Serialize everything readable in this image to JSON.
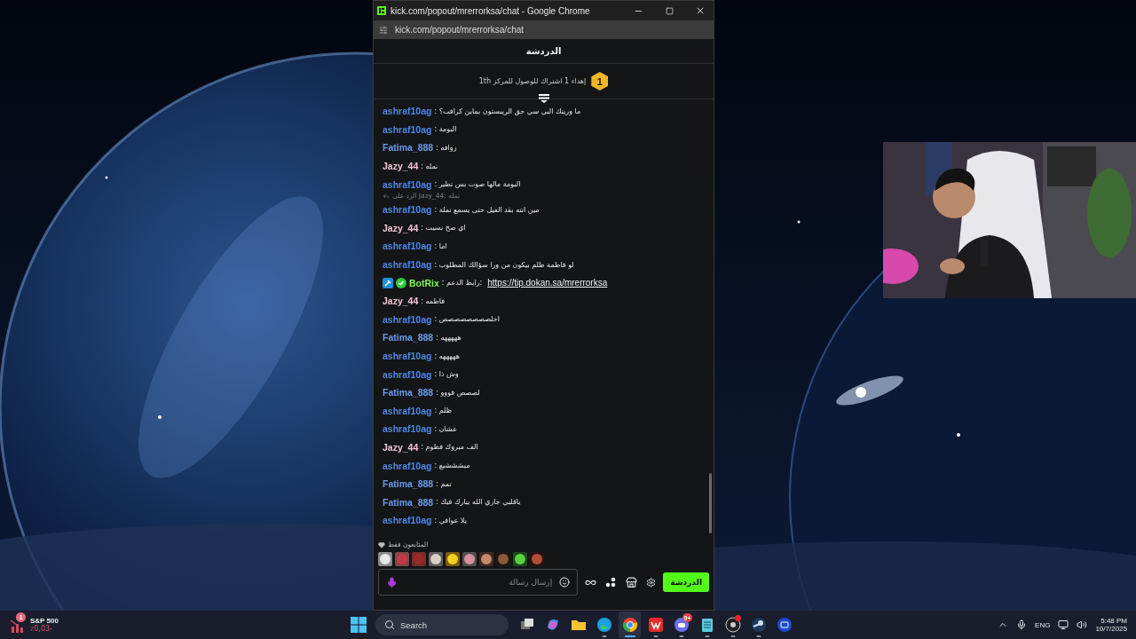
{
  "window": {
    "title": "kick.com/popout/mrerrorksa/chat - Google Chrome",
    "address": "kick.com/popout/mrerrorksa/chat"
  },
  "chat": {
    "title": "الدردشة",
    "pinned": {
      "badge": "1",
      "text": "إهداء 1 اشتراك للوصول للمركز 1th"
    },
    "messages": [
      {
        "kind": "message",
        "user": "ashraf10ag",
        "color": "#4f86e3",
        "text": ": ما وريتك البي سي حق الريبستون بماين كرافت؟"
      },
      {
        "kind": "message",
        "user": "ashraf10ag",
        "color": "#4f86e3",
        "text": ": البومة"
      },
      {
        "kind": "message",
        "user": "Fatima_888",
        "color": "#6b9ae6",
        "text": ": زوافه"
      },
      {
        "kind": "message",
        "user": "Jazy_44",
        "color": "#f1c4d4",
        "text": ": نمله"
      },
      {
        "kind": "message",
        "user": "ashraf10ag",
        "color": "#4f86e3",
        "text": ": البومة مالها صوت بس تطير"
      },
      {
        "kind": "reply",
        "text": "الرد على Jazy_44: نمله"
      },
      {
        "kind": "message",
        "user": "ashraf10ag",
        "color": "#4f86e3",
        "text": ": مين انته بقد الفيل حتى يسمع نملة"
      },
      {
        "kind": "message",
        "user": "Jazy_44",
        "color": "#f1c4d4",
        "text": ": اي صح نسيت"
      },
      {
        "kind": "message",
        "user": "ashraf10ag",
        "color": "#4f86e3",
        "text": ": اما"
      },
      {
        "kind": "message",
        "user": "ashraf10ag",
        "color": "#4f86e3",
        "text": ": لو فاطمة ظلم بيكون من ورا سؤالك المطلوب"
      },
      {
        "kind": "bot",
        "user": "BotRix",
        "color": "#7cf45a",
        "text": ": رابط الدعم:",
        "link": "https://tip.dokan.sa/mrerrorksa"
      },
      {
        "kind": "message",
        "user": "Jazy_44",
        "color": "#f1c4d4",
        "text": ": فاطمه"
      },
      {
        "kind": "message",
        "user": "ashraf10ag",
        "color": "#4f86e3",
        "text": ": اخلصصصصصصصص"
      },
      {
        "kind": "message",
        "user": "Fatima_888",
        "color": "#6b9ae6",
        "text": ": هههههه"
      },
      {
        "kind": "message",
        "user": "ashraf10ag",
        "color": "#4f86e3",
        "text": ": هههههه"
      },
      {
        "kind": "message",
        "user": "ashraf10ag",
        "color": "#4f86e3",
        "text": ": وش ذا"
      },
      {
        "kind": "message",
        "user": "Fatima_888",
        "color": "#6b9ae6",
        "text": ": لصصص قووو"
      },
      {
        "kind": "message",
        "user": "ashraf10ag",
        "color": "#4f86e3",
        "text": ": ظلم"
      },
      {
        "kind": "message",
        "user": "ashraf10ag",
        "color": "#4f86e3",
        "text": ": عشان"
      },
      {
        "kind": "message",
        "user": "Jazy_44",
        "color": "#f1c4d4",
        "text": ": الف مبروك فطوم"
      },
      {
        "kind": "message",
        "user": "ashraf10ag",
        "color": "#4f86e3",
        "text": ": مبشششبع"
      },
      {
        "kind": "message",
        "user": "Fatima_888",
        "color": "#6b9ae6",
        "text": ": تمم"
      },
      {
        "kind": "message",
        "user": "Fatima_888",
        "color": "#6b9ae6",
        "text": ": ياقلبي جازي الله يبارك فيك"
      },
      {
        "kind": "message",
        "user": "ashraf10ag",
        "color": "#4f86e3",
        "text": ": يلا عوافي"
      }
    ],
    "followers_only": "المتابعون فقط",
    "input": {
      "placeholder": "إرسال رسالة"
    },
    "send_button": "الدردشة"
  },
  "taskbar": {
    "widget": {
      "badge": "1",
      "name": "S&P 500",
      "change": "٪0,03-"
    },
    "search": {
      "label": "Search"
    },
    "apps": [
      {
        "kind": "taskview",
        "running": false,
        "active": false
      },
      {
        "kind": "copilot",
        "running": false,
        "active": false
      },
      {
        "kind": "folder",
        "running": false,
        "active": false
      },
      {
        "kind": "edge",
        "running": true,
        "active": false
      },
      {
        "kind": "chrome",
        "running": true,
        "active": true
      },
      {
        "kind": "wps",
        "running": true,
        "active": false
      },
      {
        "kind": "discord",
        "running": true,
        "active": false,
        "badge": "9+"
      },
      {
        "kind": "notepad",
        "running": true,
        "active": false
      },
      {
        "kind": "obs",
        "running": true,
        "active": false,
        "alert": true
      },
      {
        "kind": "steam",
        "running": true,
        "active": false
      },
      {
        "kind": "blueapp",
        "running": false,
        "active": false
      }
    ],
    "tray": {
      "language": "ENG",
      "time": "5:48 PM",
      "date": "10/7/2025"
    }
  }
}
